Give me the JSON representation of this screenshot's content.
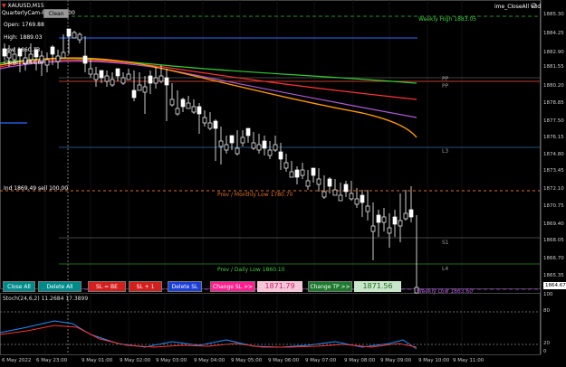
{
  "header": {
    "symbol": "XAUUSD,M15",
    "indicator_name": "QuarterlyCam-Pivots v1.00",
    "top_button": "Clean",
    "top_right_label": "ime_CloseAll v3d"
  },
  "info": {
    "open": "Open: 1769.88",
    "high": "High: 1889.03",
    "low": "Low: 1860.13",
    "close": "Close: 1864.67",
    "ind_label": "Ind 1869.49 sell 100.00"
  },
  "lines": {
    "weekly_high": "Weekly High 1883.05",
    "pp1": "PP",
    "pp2": "PP",
    "l3": "L3",
    "prev_monthly_low": "Prev / Monthly Low 1780.70",
    "s1": "S1",
    "prev_daily_low": "Prev / Daily Low 1860.10",
    "l4": "L4",
    "weekly_low": "Weekly Low 1863.60"
  },
  "buttons": {
    "close_all": "Close All",
    "delete_all": "Delete All",
    "sl_be": "SL = BE",
    "sl_plus": "SL + 1",
    "delete_sl": "Delete SL",
    "change_sl": "Change SL >>",
    "sl_value": "1871.79",
    "change_tp": "Change TP >>",
    "tp_value": "1871.56"
  },
  "price_axis": [
    "1885.30",
    "1884.25",
    "1882.90",
    "1881.55",
    "1880.20",
    "1878.85",
    "1877.50",
    "1876.15",
    "1874.80",
    "1873.45",
    "1872.10",
    "1870.75",
    "1869.40",
    "1868.05",
    "1866.70",
    "1865.35",
    "1864.67"
  ],
  "stoch": {
    "label": "Stoch(24,6,2) 11.2684 17.3899",
    "axis": [
      "100",
      "80",
      "20",
      "0"
    ]
  },
  "time_axis": [
    "6 May 2022",
    "6 May 23:00",
    "9 May 01:00",
    "9 May 02:00",
    "9 May 03:00",
    "9 May 04:00",
    "9 May 05:00",
    "9 May 06:00",
    "9 May 07:00",
    "9 May 08:00",
    "9 May 09:00",
    "9 May 10:00",
    "9 May 11:00"
  ],
  "colors": {
    "candle": "#ffffff",
    "grid": "#2a2a2a",
    "accent_green": "#44cc44",
    "accent_red": "#e53935",
    "ma_orange": "#ff9800",
    "ma_violet": "#b05cd8",
    "ma_red": "#ff3333",
    "ma_green": "#33cc33",
    "stoch_main": "#1e90ff",
    "stoch_signal": "#ff3030"
  }
}
